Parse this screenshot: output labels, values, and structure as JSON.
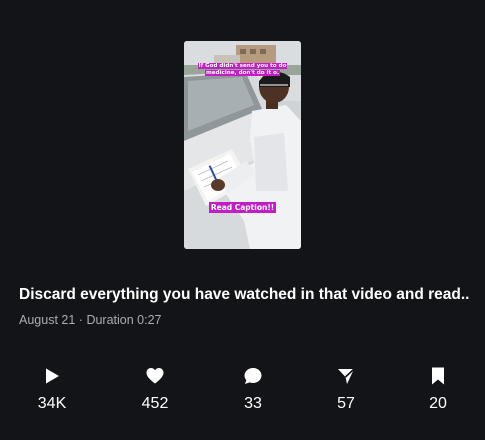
{
  "video": {
    "thumbnail_icon": "video-thumbnail",
    "overlay_caption_top": "If God didn't send you to do medicine, don't do it o.",
    "overlay_caption_bottom": "Read Caption!!",
    "caption_color": "#c21ec8",
    "title": "Discard everything you have watched in that video and read...",
    "date": "August 21",
    "separator": "·",
    "duration": "Duration 0:27"
  },
  "stats": [
    {
      "icon": "play-icon",
      "value": "34K"
    },
    {
      "icon": "heart-icon",
      "value": "452"
    },
    {
      "icon": "comment-icon",
      "value": "33"
    },
    {
      "icon": "share-icon",
      "value": "57"
    },
    {
      "icon": "bookmark-icon",
      "value": "20"
    }
  ]
}
